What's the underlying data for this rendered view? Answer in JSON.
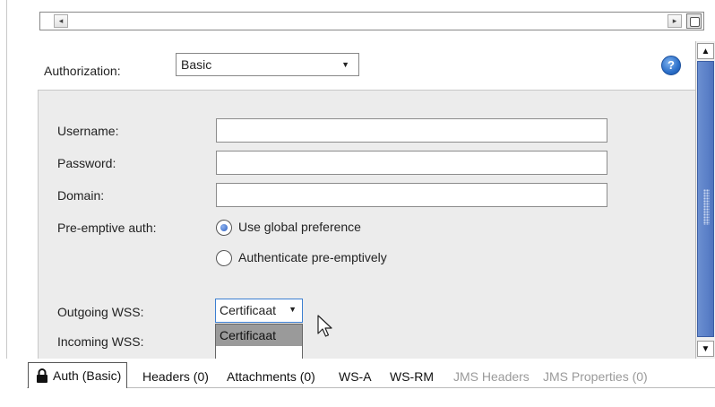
{
  "authorization": {
    "label": "Authorization:",
    "selected": "Basic"
  },
  "help_icon": "help-icon",
  "fields": {
    "username_label": "Username:",
    "username_value": "",
    "password_label": "Password:",
    "password_value": "",
    "domain_label": "Domain:",
    "domain_value": ""
  },
  "preemptive": {
    "label": "Pre-emptive auth:",
    "options": [
      {
        "label": "Use global preference",
        "selected": true
      },
      {
        "label": "Authenticate pre-emptively",
        "selected": false
      }
    ]
  },
  "wss": {
    "outgoing_label": "Outgoing WSS:",
    "outgoing_selected": "Certificaat",
    "incoming_label": "Incoming WSS:",
    "dropdown_options": [
      "Certificaat",
      ""
    ]
  },
  "tabs": [
    {
      "label": "Auth (Basic)",
      "active": true,
      "enabled": true
    },
    {
      "label": "Headers (0)",
      "active": false,
      "enabled": true
    },
    {
      "label": "Attachments (0)",
      "active": false,
      "enabled": true
    },
    {
      "label": "WS-A",
      "active": false,
      "enabled": true
    },
    {
      "label": "WS-RM",
      "active": false,
      "enabled": true
    },
    {
      "label": "JMS Headers",
      "active": false,
      "enabled": false
    },
    {
      "label": "JMS Properties (0)",
      "active": false,
      "enabled": false
    }
  ],
  "colors": {
    "panel_bg": "#ececec",
    "scroll_thumb": "#5b80c8",
    "focus_border": "#3c7fd1",
    "disabled_text": "#9a9a9a"
  }
}
